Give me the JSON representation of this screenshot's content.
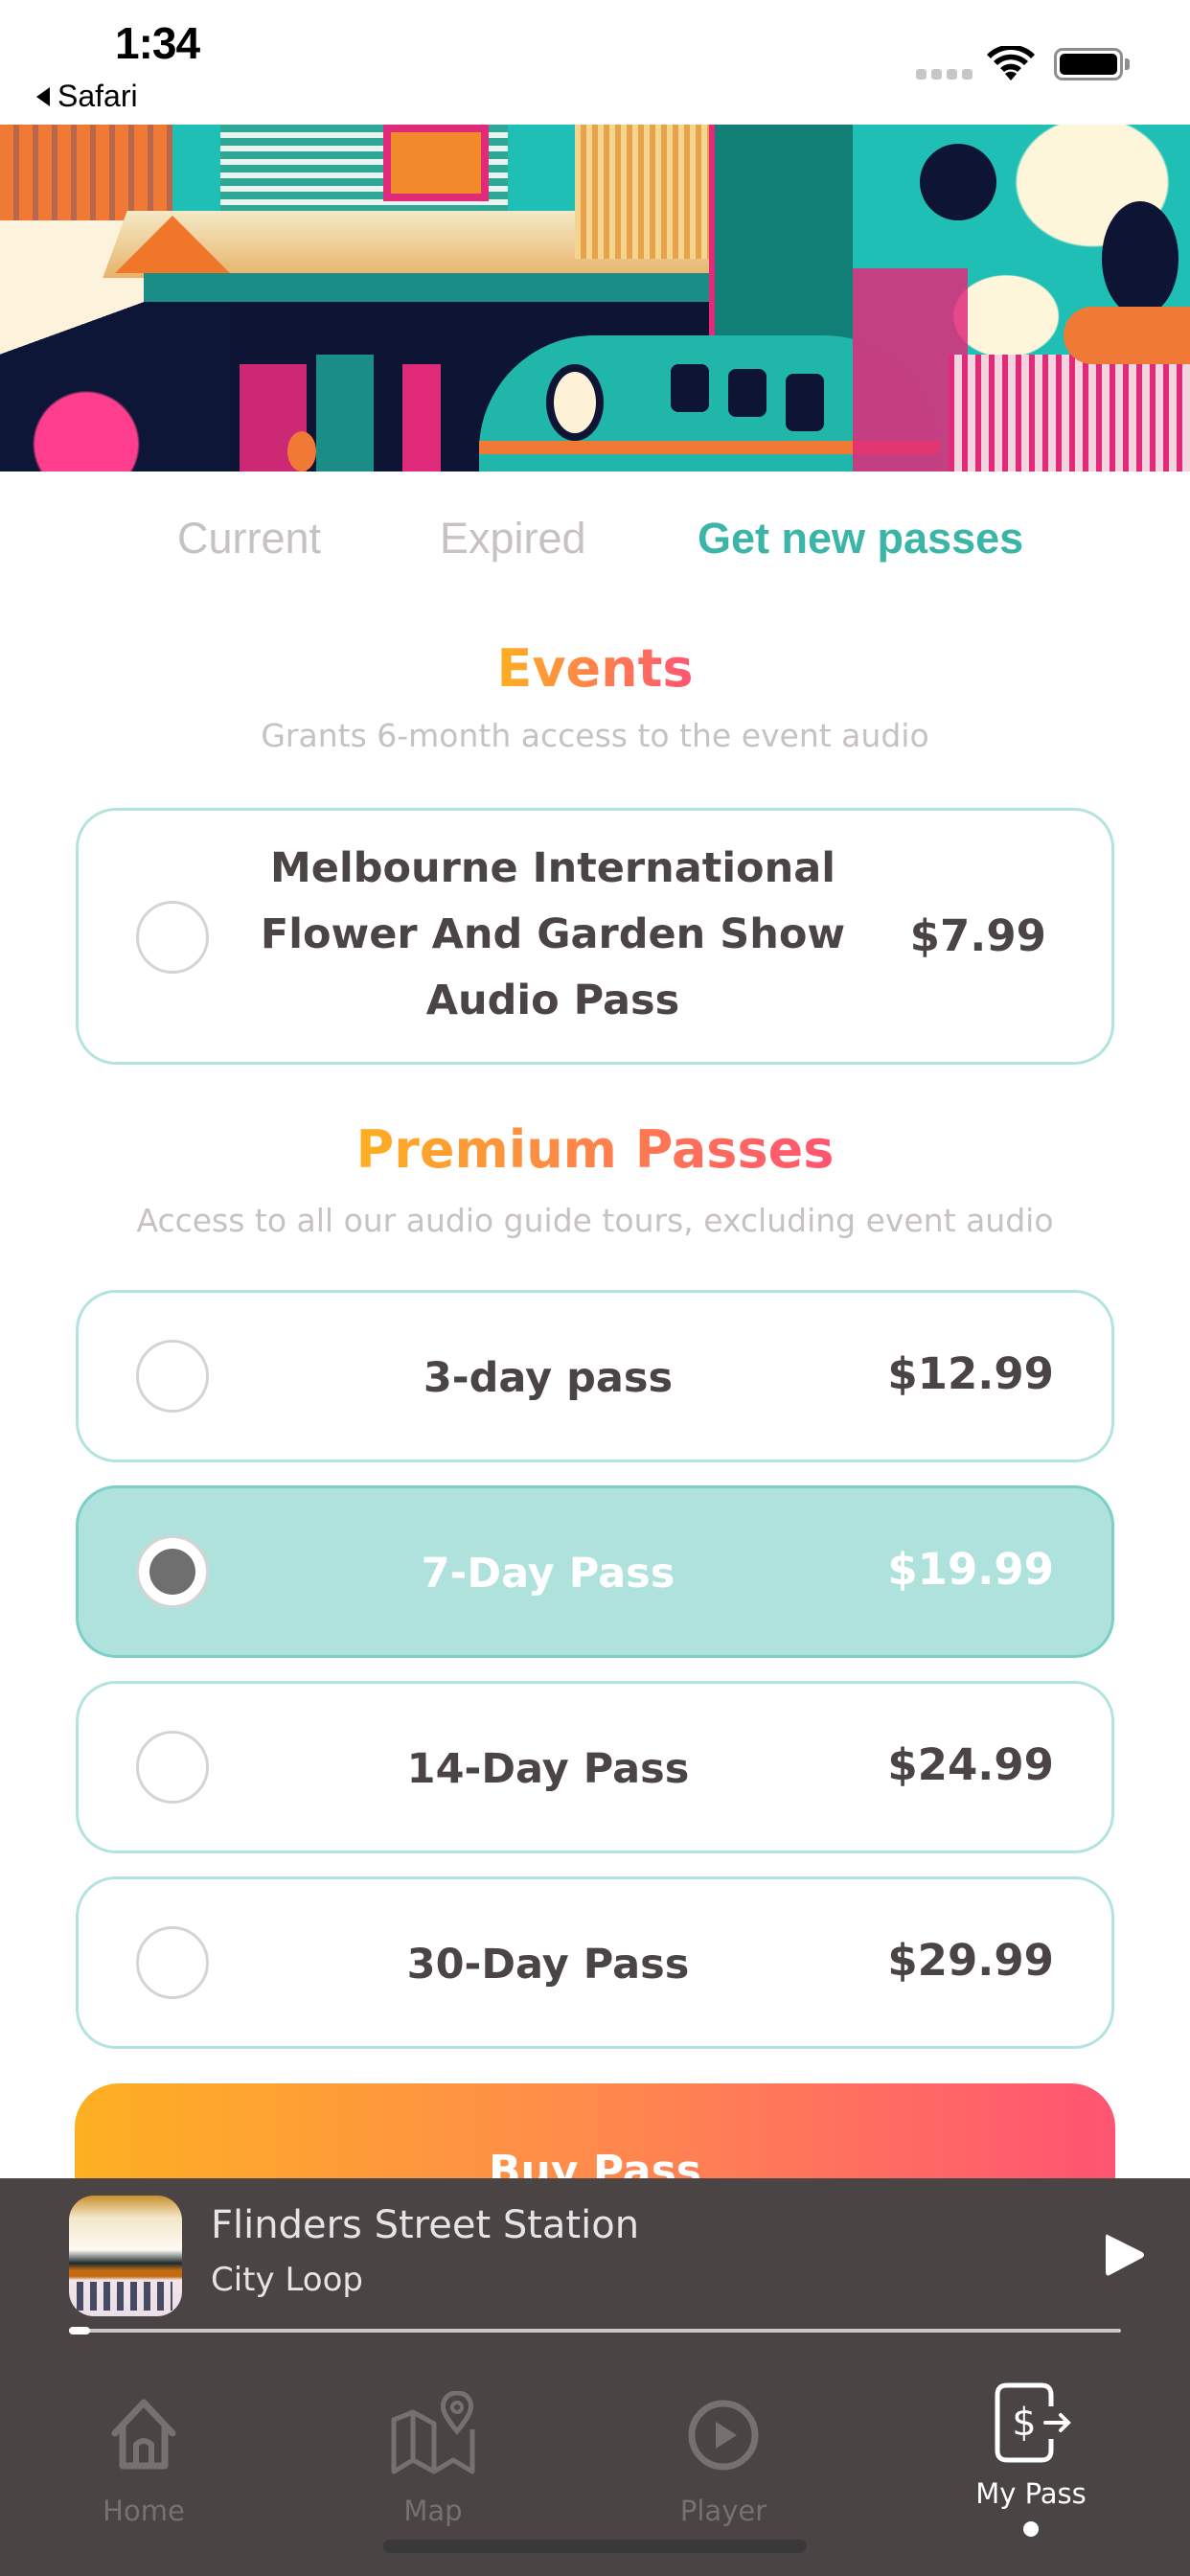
{
  "status_bar": {
    "time": "1:34",
    "back_label": "Safari"
  },
  "hero": {
    "image": "illustrated-train-station-banner"
  },
  "tabs": [
    {
      "label": "Current",
      "active": false
    },
    {
      "label": "Expired",
      "active": false
    },
    {
      "label": "Get new passes",
      "active": true
    }
  ],
  "events": {
    "title": "Events",
    "subtitle": "Grants 6-month access to the event audio",
    "items": [
      {
        "name_lines": [
          "Melbourne International",
          "Flower And Garden Show",
          "Audio Pass"
        ],
        "price": "$7.99",
        "selected": false
      }
    ]
  },
  "premium": {
    "title": "Premium Passes",
    "subtitle": "Access to all our audio guide tours, excluding event audio",
    "items": [
      {
        "name": "3-day pass",
        "price": "$12.99",
        "selected": false
      },
      {
        "name": "7-Day Pass",
        "price": "$19.99",
        "selected": true
      },
      {
        "name": "14-Day Pass",
        "price": "$24.99",
        "selected": false
      },
      {
        "name": "30-Day Pass",
        "price": "$29.99",
        "selected": false
      }
    ]
  },
  "buy_button": {
    "label": "Buy Pass"
  },
  "player": {
    "title": "Flinders Street Station",
    "subtitle": "City Loop",
    "progress_percent": 2,
    "play_icon": "play-icon"
  },
  "tabbar": {
    "items": [
      {
        "label": "Home",
        "icon": "home-icon",
        "active": false
      },
      {
        "label": "Map",
        "icon": "map-icon",
        "active": false
      },
      {
        "label": "Player",
        "icon": "play-circle-icon",
        "active": false
      },
      {
        "label": "My Pass",
        "icon": "pass-icon",
        "active": true
      }
    ]
  },
  "colors": {
    "accent_teal": "#3bb5a8",
    "card_border": "#b2e4df",
    "card_selected_bg": "#b0e2dd",
    "gradient_start": "#fdb022",
    "gradient_end": "#ff5472",
    "player_bg": "#4a4544",
    "text_dark": "#4a4544",
    "text_muted": "#c6c2c1"
  }
}
